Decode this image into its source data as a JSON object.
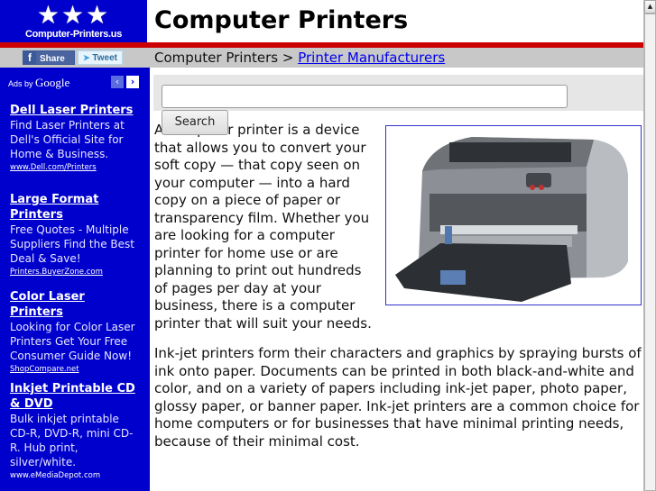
{
  "logo": {
    "stars": "★★★",
    "site_name": "Computer-Printers.us"
  },
  "social": {
    "share_icon": "f",
    "share_label": "Share",
    "tweet_icon": "bird-icon",
    "tweet_label": "Tweet"
  },
  "ads": {
    "label_prefix": "Ads by",
    "label_brand": "Google",
    "prev_icon": "‹",
    "next_icon": "›",
    "items": [
      {
        "title": "Dell Laser Printers",
        "description": "Find Laser Printers at Dell's Official Site for Home & Business.",
        "url": "www.Dell.com/Printers"
      },
      {
        "title": "Large Format Printers",
        "description": "Free Quotes - Multiple Suppliers Find the Best Deal & Save!",
        "url": "Printers.BuyerZone.com"
      },
      {
        "title": "Color Laser Printers",
        "description": "Looking for Color Laser Printers Get Your Free Consumer Guide Now!",
        "url": "ShopCompare.net"
      },
      {
        "title": "Inkjet Printable CD & DVD",
        "description": "Bulk inkjet printable CD-R, DVD-R, mini CD-R. Hub print, silver/white.",
        "url": "www.eMediaDepot.com"
      }
    ]
  },
  "header": {
    "title": "Computer Printers"
  },
  "breadcrumb": {
    "current": "Computer Printers",
    "separator": ">",
    "link": "Printer Manufacturers"
  },
  "search": {
    "value": "",
    "placeholder": "",
    "button_label": "Search"
  },
  "figure": {
    "alt": "Computer printer photo"
  },
  "content": {
    "paragraphs": [
      "A computer printer is a device that allows you to convert your soft copy — that copy seen on your computer — into a hard copy on a piece of paper or transparency film.  Whether you are looking for a computer printer for home use or are planning to print out hundreds of pages per day at your business, there is a computer printer that will suit your needs.",
      "Ink-jet printers form their characters and graphics by spraying bursts of ink onto paper.  Documents can be printed in both black-and-white and color, and on a variety of papers including ink-jet paper, photo paper, glossy paper, or banner paper.  Ink-jet printers are a common choice for home computers or for businesses that have minimal printing needs, because of their minimal cost."
    ]
  },
  "colors": {
    "sidebar": "#0000cc",
    "accent_line": "#cc0000",
    "bar_gray": "#c8c8c8",
    "link": "#0000ee"
  }
}
